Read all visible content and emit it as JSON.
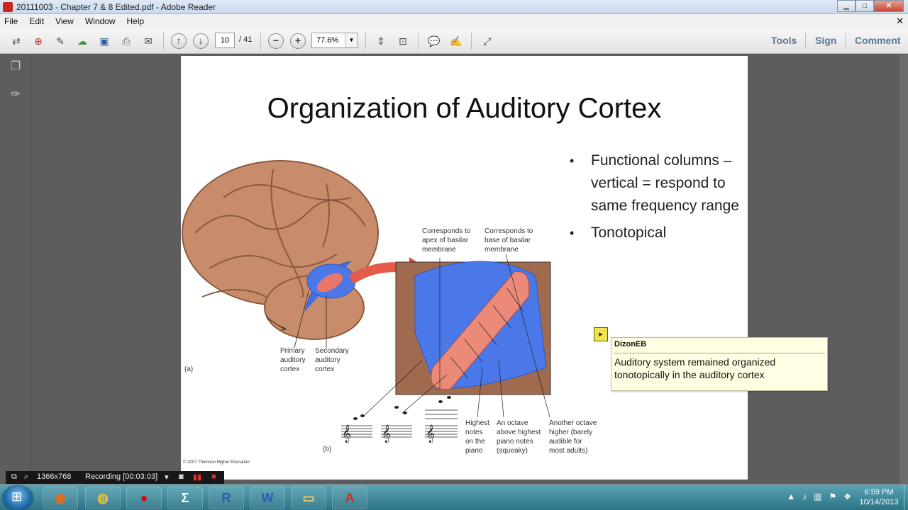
{
  "window": {
    "title": "20111003 - Chapter 7 & 8 Edited.pdf - Adobe Reader",
    "min": "▁",
    "max": "□",
    "close": "✕"
  },
  "menu": [
    "File",
    "Edit",
    "View",
    "Window",
    "Help"
  ],
  "toolbar": {
    "page_current": "10",
    "page_total": "/ 41",
    "zoom": "77.6%",
    "tools": "Tools",
    "sign": "Sign",
    "comment": "Comment"
  },
  "slide": {
    "title": "Organization of Auditory Cortex",
    "bullets": [
      "Functional columns – vertical = respond to same frequency range",
      "Tonotopical"
    ],
    "figure": {
      "label_a": "(a)",
      "label_b": "(b)",
      "primary": [
        "Primary",
        "auditory",
        "cortex"
      ],
      "secondary": [
        "Secondary",
        "auditory",
        "cortex"
      ],
      "apex": [
        "Corresponds to",
        "apex of basilar",
        "membrane"
      ],
      "base": [
        "Corresponds to",
        "base of basilar",
        "membrane"
      ],
      "highest": [
        "Highest",
        "notes",
        "on the",
        "piano"
      ],
      "octave": [
        "An octave",
        "above highest",
        "piano notes",
        "(squeaky)"
      ],
      "another": [
        "Another octave",
        "higher (barely",
        "audible for",
        "most adults)"
      ],
      "copyright": "© 2007 Thomson Higher Education"
    }
  },
  "comment_note": {
    "author": "DizonEB",
    "text": "Auditory system remained organized tonotopically in the auditory cortex"
  },
  "recorder": {
    "resolution": "1366x768",
    "status": "Recording [00:03:03]"
  },
  "taskbar": {
    "time": "6:59 PM",
    "date": "10/14/2013"
  }
}
